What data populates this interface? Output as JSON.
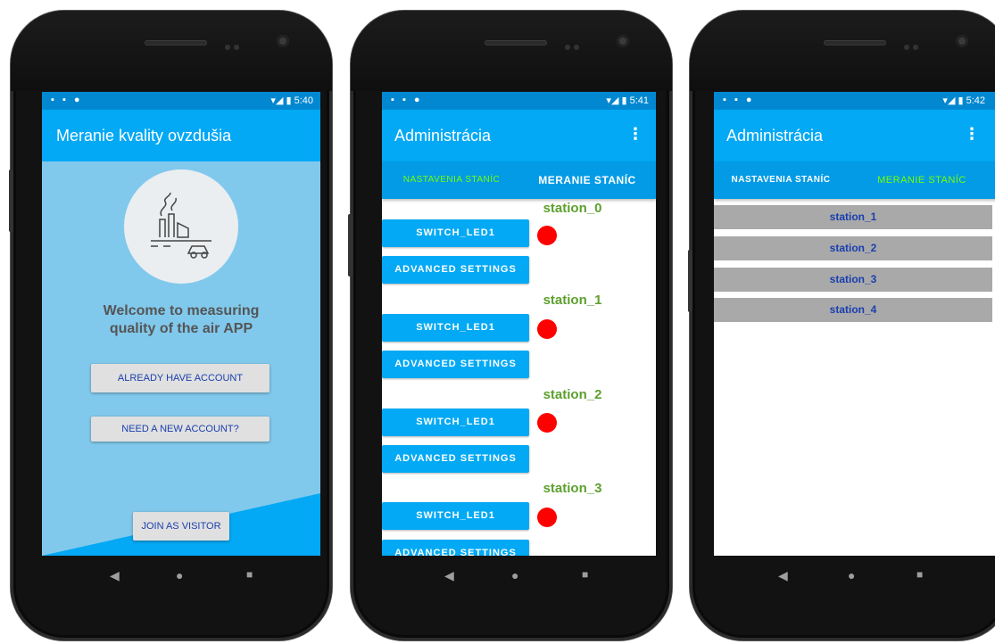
{
  "phone1": {
    "status_time": "5:40",
    "status_icons": "▪ ▪ ●",
    "status_right_icons": "▾◢ ▮",
    "app_title": "Meranie kvality ovzdušia",
    "welcome_line1": "Welcome to measuring",
    "welcome_line2": "quality of the air APP",
    "already_btn": "ALREADY HAVE ACCOUNT",
    "new_btn": "NEED A NEW ACCOUNT?",
    "visitor_btn": "JOIN AS VISITOR"
  },
  "phone2": {
    "status_time": "5:41",
    "status_icons": "▪ ▪ ●",
    "status_right_icons": "▾◢ ▮",
    "app_title": "Administrácia",
    "menu_icon": "⋮",
    "tab_settings": "NASTAVENIA STANÍC",
    "tab_measure": "MERANIE STANÍC",
    "stations": [
      {
        "name": "station_0",
        "switch": "SWITCH_LED1",
        "advanced": "ADVANCED SETTINGS"
      },
      {
        "name": "station_1",
        "switch": "SWITCH_LED1",
        "advanced": "ADVANCED SETTINGS"
      },
      {
        "name": "station_2",
        "switch": "SWITCH_LED1",
        "advanced": "ADVANCED SETTINGS"
      },
      {
        "name": "station_3",
        "switch": "SWITCH_LED1",
        "advanced": "ADVANCED SETTINGS"
      }
    ]
  },
  "phone3": {
    "status_time": "5:42",
    "status_icons": "▪ ▪ ●",
    "status_right_icons": "▾◢ ▮",
    "app_title": "Administrácia",
    "menu_icon": "⋮",
    "tab_settings": "NASTAVENIA STANÍC",
    "tab_measure": "MERANIE STANÍC",
    "stations": [
      "station_1",
      "station_2",
      "station_3",
      "station_4"
    ]
  },
  "nav": {
    "back": "◀",
    "home": "●",
    "recent": "■"
  },
  "colors": {
    "primary": "#03a9f4",
    "status": "#0288d1",
    "green_title": "#5da02e",
    "active_tab": "#76ff03",
    "led_red": "#ff0000"
  }
}
